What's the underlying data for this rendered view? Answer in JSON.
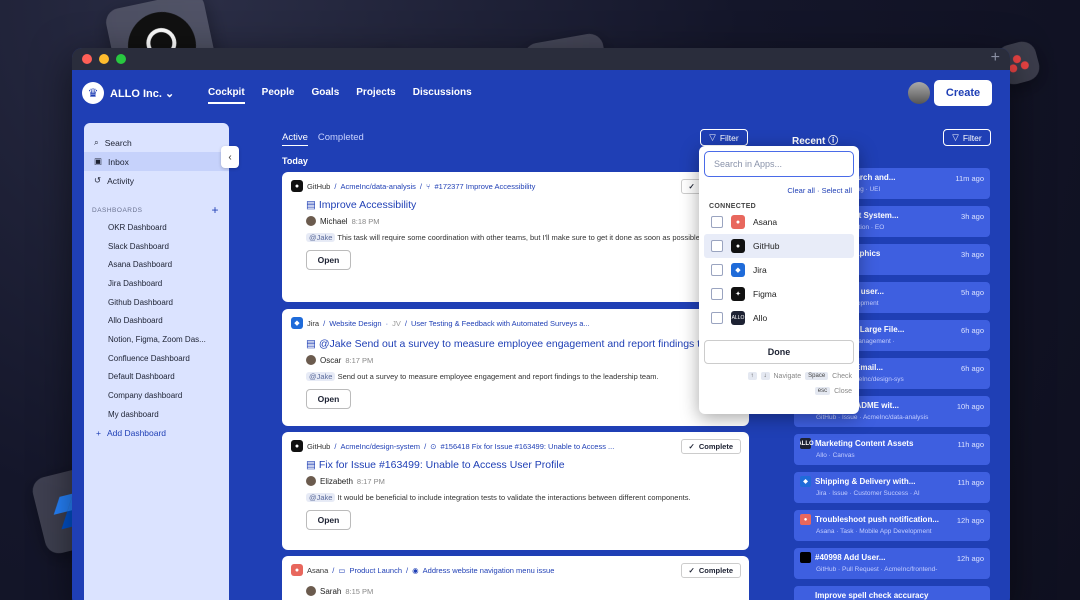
{
  "nav": {
    "org": "ALLO Inc.",
    "links": [
      "Cockpit",
      "People",
      "Goals",
      "Projects",
      "Discussions"
    ],
    "create": "Create"
  },
  "sidebar": {
    "items": [
      "Search",
      "Inbox",
      "Activity"
    ],
    "dash_header": "DASHBOARDS",
    "dashboards": [
      "OKR Dashboard",
      "Slack Dashboard",
      "Asana Dashboard",
      "Jira Dashboard",
      "Github Dashboard",
      "Allo Dashboard",
      "Notion, Figma, Zoom Das...",
      "Confluence Dashboard",
      "Default Dashboard",
      "Company dashboard",
      "My dashboard"
    ],
    "add": "Add Dashboard"
  },
  "feed": {
    "tabs": [
      "Active",
      "Completed"
    ],
    "today": "Today",
    "filter": "Filter",
    "open": "Open",
    "complete": "Complete",
    "cards": [
      {
        "app": "GitHub",
        "path": "AcmeInc/data-analysis",
        "ref": "#172377 Improve Accessibility",
        "title": "Improve Accessibility",
        "user": "Michael",
        "time": "8:18 PM",
        "mention": "@Jake",
        "body": "This task will require some coordination with other teams, but I'll make sure to get it done as soon as possible."
      },
      {
        "app": "Jira",
        "path": "Website Design",
        "tag": "JV",
        "ref": "User Testing & Feedback with Automated Surveys a...",
        "title": "@Jake Send out a survey to measure employee engagement and report findings to the leadership team.",
        "user": "Oscar",
        "time": "8:17 PM",
        "mention": "@Jake",
        "body": "Send out a survey to measure employee engagement and report findings to the leadership team."
      },
      {
        "app": "GitHub",
        "path": "AcmeInc/design-system",
        "ref": "#156418 Fix for Issue #163499: Unable to Access ...",
        "title": "Fix for Issue #163499: Unable to Access User Profile",
        "user": "Elizabeth",
        "time": "8:17 PM",
        "mention": "@Jake",
        "body": "It would be beneficial to include integration tests to validate the interactions between different components."
      },
      {
        "app": "Asana",
        "path": "Product Launch",
        "ref": "Address website navigation menu issue",
        "title": "",
        "user": "Sarah",
        "time": "8:15 PM",
        "mention": "",
        "body": ""
      }
    ]
  },
  "recent": {
    "title": "Recent",
    "filter": "Filter",
    "items": [
      {
        "t": "word Research and...",
        "s": "nployee Training · UEI",
        "time": "11m ago",
        "ico": "",
        "c": "#3e5fe0"
      },
      {
        "t": "esk Support System...",
        "s": "ustomer Retention · EO",
        "time": "3h ago",
        "ico": "",
        "c": "#3e5fe0"
      },
      {
        "t": "sitation Graphics",
        "s": "",
        "time": "3h ago",
        "ico": "",
        "c": "#3e5fe0"
      },
      {
        "t": "istomizable user...",
        "s": "Product Development",
        "time": "5h ago",
        "ico": "",
        "c": "#3e5fe0"
      },
      {
        "t": "en Loading Large File...",
        "s": "kes Pipeline Management · ",
        "time": "6h ago",
        "ico": "",
        "c": "#3e5fe0"
      },
      {
        "t": "mplement Email...",
        "s": "Request · AcmeInc/design-sys",
        "time": "6h ago",
        "ico": "",
        "c": "#3e5fe0"
      },
      {
        "t": "Update README wit...",
        "s": "GitHub · Issue · AcmeInc/data-analysis",
        "time": "10h ago",
        "ico": "",
        "c": "#000"
      },
      {
        "t": "Marketing Content Assets",
        "s": "Allo · Canvas",
        "time": "11h ago",
        "ico": "ALLO",
        "c": "#1d2233"
      },
      {
        "t": "Shipping & Delivery with...",
        "s": "Jira · Issue · Customer Success · AI",
        "time": "11h ago",
        "ico": "◆",
        "c": "#1f6bd9"
      },
      {
        "t": "Troubleshoot push notification...",
        "s": "Asana · Task · Mobile App Development",
        "time": "12h ago",
        "ico": "●",
        "c": "#e8675d"
      },
      {
        "t": "#40998 Add User...",
        "s": "GitHub · Pull Request · AcmeInc/frontend-",
        "time": "12h ago",
        "ico": "",
        "c": "#000"
      },
      {
        "t": "Improve spell check accuracy",
        "s": "",
        "time": "",
        "ico": "",
        "c": "#3e5fe0"
      }
    ]
  },
  "dropdown": {
    "search_placeholder": "Search in Apps...",
    "clear": "Clear all · Select all",
    "connected": "CONNECTED",
    "apps": [
      "Asana",
      "GitHub",
      "Jira",
      "Figma",
      "Allo"
    ],
    "done": "Done",
    "navigate": "Navigate",
    "space": "Space",
    "check": "Check",
    "esc": "esc",
    "close": "Close"
  }
}
